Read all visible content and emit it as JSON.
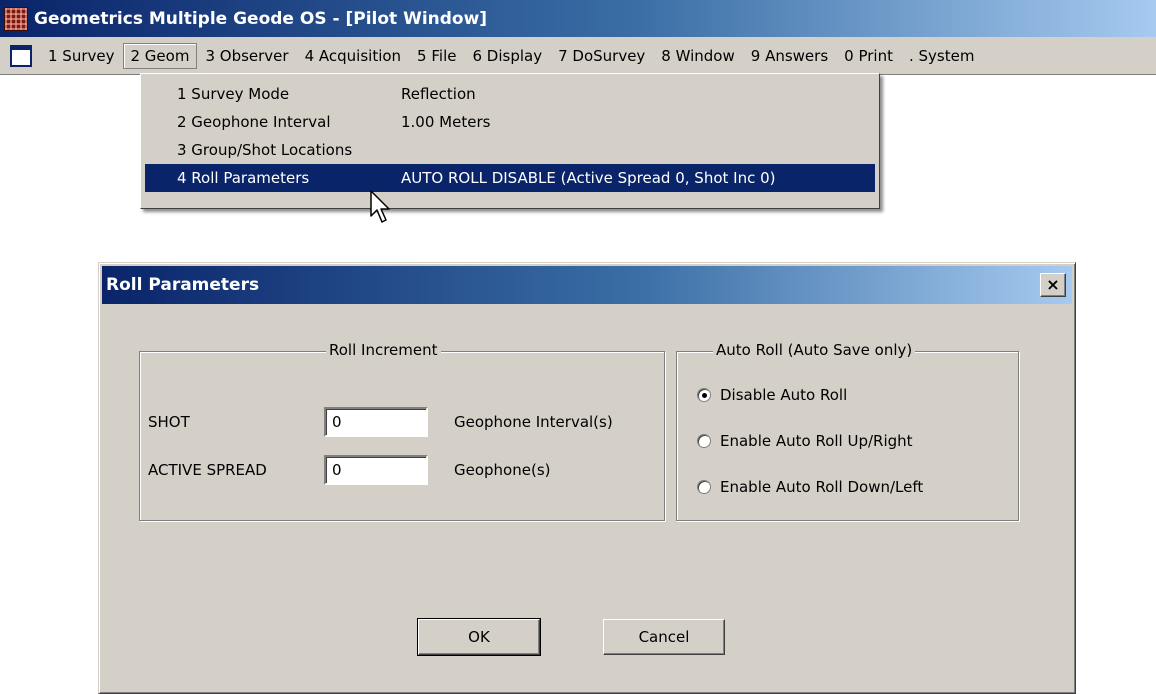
{
  "app": {
    "title": "Geometrics Multiple Geode OS - [Pilot Window]"
  },
  "menubar": {
    "items": [
      {
        "label": "1 Survey"
      },
      {
        "label": "2 Geom",
        "open": true
      },
      {
        "label": "3 Observer"
      },
      {
        "label": "4 Acquisition"
      },
      {
        "label": "5 File"
      },
      {
        "label": "6 Display"
      },
      {
        "label": "7 DoSurvey"
      },
      {
        "label": "8 Window"
      },
      {
        "label": "9 Answers"
      },
      {
        "label": "0 Print"
      },
      {
        "label": ". System"
      }
    ]
  },
  "dropdown": {
    "items": [
      {
        "label": "1 Survey Mode",
        "value": "Reflection"
      },
      {
        "label": "2 Geophone Interval",
        "value": "1.00  Meters"
      },
      {
        "label": "3 Group/Shot Locations",
        "value": ""
      },
      {
        "label": "4 Roll Parameters",
        "value": "AUTO ROLL DISABLE (Active Spread 0, Shot Inc 0)",
        "selected": true
      }
    ]
  },
  "dialog": {
    "title": "Roll Parameters",
    "close_glyph": "×",
    "roll_increment": {
      "legend": "Roll Increment",
      "shot": {
        "label": "SHOT",
        "value": "0",
        "unit": "Geophone Interval(s)"
      },
      "active_spread": {
        "label": "ACTIVE SPREAD",
        "value": "0",
        "unit": "Geophone(s)"
      }
    },
    "auto_roll": {
      "legend": "Auto Roll (Auto Save only)",
      "options": [
        {
          "label": "Disable Auto Roll",
          "checked": true
        },
        {
          "label": "Enable Auto Roll Up/Right",
          "checked": false
        },
        {
          "label": "Enable Auto Roll Down/Left",
          "checked": false
        }
      ]
    },
    "ok_label": "OK",
    "cancel_label": "Cancel"
  }
}
